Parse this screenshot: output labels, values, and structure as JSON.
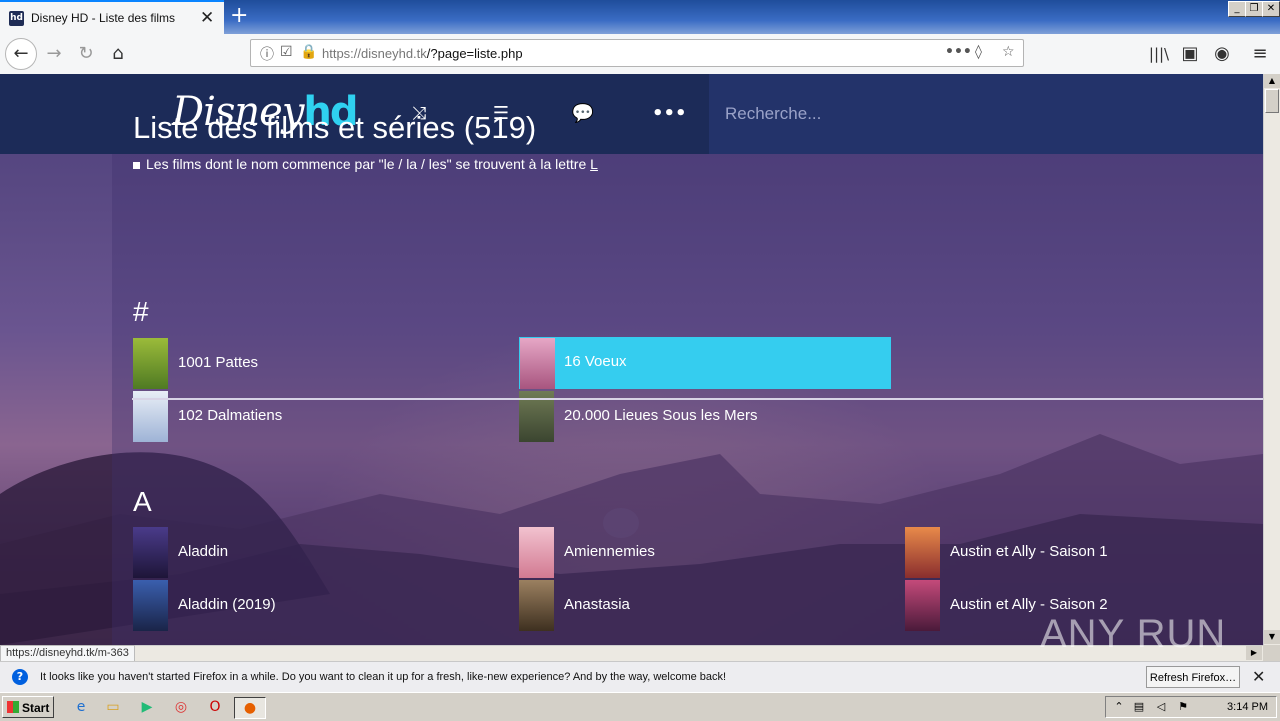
{
  "browser": {
    "tab_title": "Disney HD - Liste des films",
    "tab_favicon": "hd",
    "url_host": "https://disneyhd.tk",
    "url_path": "/?page=liste.php",
    "status_url": "https://disneyhd.tk/m-363"
  },
  "site": {
    "logo_text": "Disney",
    "logo_suffix": "hd",
    "search_placeholder": "Recherche...",
    "nav_icons": [
      "shuffle-icon",
      "list-icon",
      "chat-icon",
      "more-icon"
    ]
  },
  "main": {
    "title": "Liste des films et séries (519)",
    "note_prefix": "Les films dont le nom commence par \"le / la / les\" se trouvent à la lettre ",
    "note_letter": "L"
  },
  "sections": [
    {
      "letter": "#",
      "items": [
        {
          "label": "1001 Pattes",
          "highlighted": false,
          "poster_color": "#6c8f2c"
        },
        {
          "label": "16 Voeux",
          "highlighted": true,
          "poster_color": "#c77aa0"
        },
        {
          "label": "102 Dalmatiens",
          "highlighted": false,
          "poster_color": "#c9d3e6"
        },
        {
          "label": "20.000 Lieues Sous les Mers",
          "highlighted": false,
          "poster_color": "#4f5d3c"
        }
      ]
    },
    {
      "letter": "A",
      "items": [
        {
          "label": "Aladdin",
          "highlighted": false,
          "poster_color": "#3a2a6a"
        },
        {
          "label": "Amiennemies",
          "highlighted": false,
          "poster_color": "#e7a2b6"
        },
        {
          "label": "Austin et Ally - Saison 1",
          "highlighted": false,
          "poster_color": "#d46a3a"
        },
        {
          "label": "Aladdin (2019)",
          "highlighted": false,
          "poster_color": "#2a4a8a"
        },
        {
          "label": "Anastasia",
          "highlighted": false,
          "poster_color": "#6a5540"
        },
        {
          "label": "Austin et Ally - Saison 2",
          "highlighted": false,
          "poster_color": "#a03060"
        }
      ]
    }
  ],
  "notification": {
    "message": "It looks like you haven't started Firefox in a while. Do you want to clean it up for a fresh, like-new experience? And by the way, welcome back!",
    "button": "Refresh Firefox…"
  },
  "taskbar": {
    "start_label": "Start",
    "clock": "3:14 PM"
  },
  "watermark": "ANY RUN"
}
